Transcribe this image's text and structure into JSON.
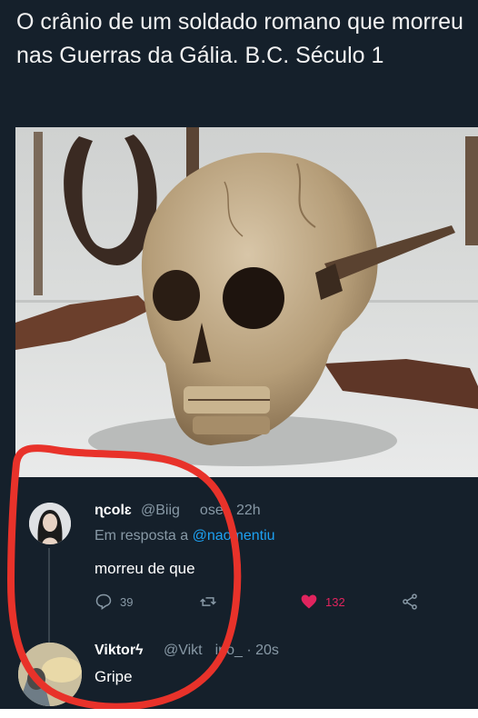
{
  "caption": "O crânio de um soldado romano que morreu nas Guerras da Gália. B.C. Século 1",
  "tweet1": {
    "name": "ɳcolɛ",
    "handle": "@Biig",
    "handle_tail": "ose",
    "time": "· 22h",
    "reply_prefix": "Em resposta a",
    "reply_mention": "@naomentiu",
    "text": "morreu de que",
    "reply_count": "39",
    "like_count": "132"
  },
  "tweet2": {
    "name": "Viktorϟ",
    "handle": "@Vikt",
    "handle_tail": "ino_",
    "time": "· 20s",
    "text": "Gripe"
  },
  "colors": {
    "background": "#15202b",
    "secondary_text": "#8899a6",
    "mention": "#1da1f2",
    "like": "#e0245e",
    "annotation_circle": "#e8322a"
  },
  "icons": [
    "reply-icon",
    "retweet-icon",
    "heart-icon",
    "share-icon"
  ]
}
